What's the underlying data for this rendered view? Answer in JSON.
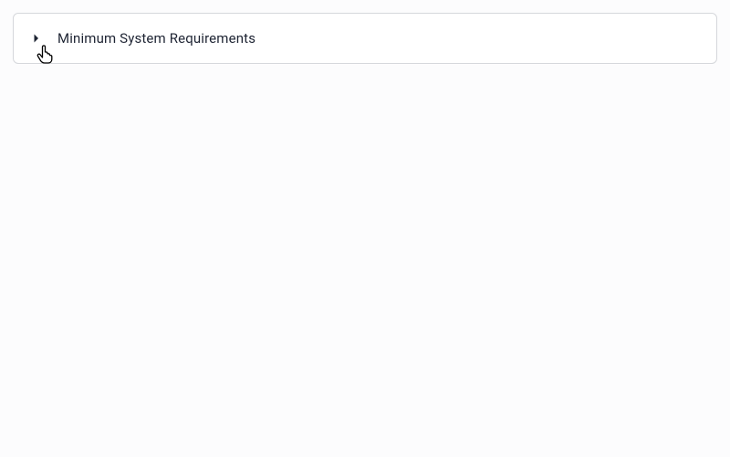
{
  "accordion": {
    "title": "Minimum System Requirements",
    "expanded": false
  }
}
